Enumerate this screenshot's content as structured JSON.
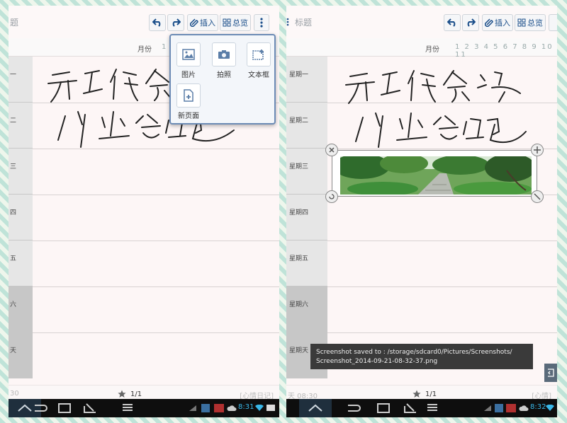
{
  "left": {
    "title": "题",
    "toolbar": {
      "insert": "插入",
      "overview": "总览"
    },
    "month_label": "月份",
    "month_num": "1",
    "days": [
      "一",
      "二",
      "三",
      "四",
      "五",
      "六",
      "天"
    ],
    "insert_menu": {
      "picture": "图片",
      "photo": "拍照",
      "textbox": "文本框",
      "new_page": "新页面"
    },
    "footer": {
      "time": "30",
      "page": "1/1",
      "brand": "[心情日记]"
    },
    "clock": "8:31"
  },
  "right": {
    "title": "标题",
    "toolbar": {
      "insert": "插入",
      "overview": "总览"
    },
    "month_label": "月份",
    "month_nums": "1 2 3 4 5 6 7 8 9 10 11",
    "days": [
      "星期一",
      "星期二",
      "星期三",
      "星期四",
      "星期五",
      "星期六",
      "星期天"
    ],
    "footer": {
      "time": "天 08:30",
      "page": "1/1",
      "brand": "[心情]"
    },
    "clock": "8:32",
    "toast_line1": "Screenshot saved to : /storage/sdcard0/Pictures/Screenshots/",
    "toast_line2": "Screenshot_2014-09-21-08-32-37.png"
  },
  "colors": {
    "accent": "#1a4e8a",
    "clock": "#39b7e8",
    "menu_border": "#6c8bb5"
  },
  "icons": [
    "undo-icon",
    "redo-icon",
    "attach-icon",
    "grid-icon",
    "more-icon",
    "picture-icon",
    "camera-icon",
    "textbox-icon",
    "new-page-icon",
    "star-icon",
    "home-icon",
    "back-icon",
    "recent-icon"
  ]
}
